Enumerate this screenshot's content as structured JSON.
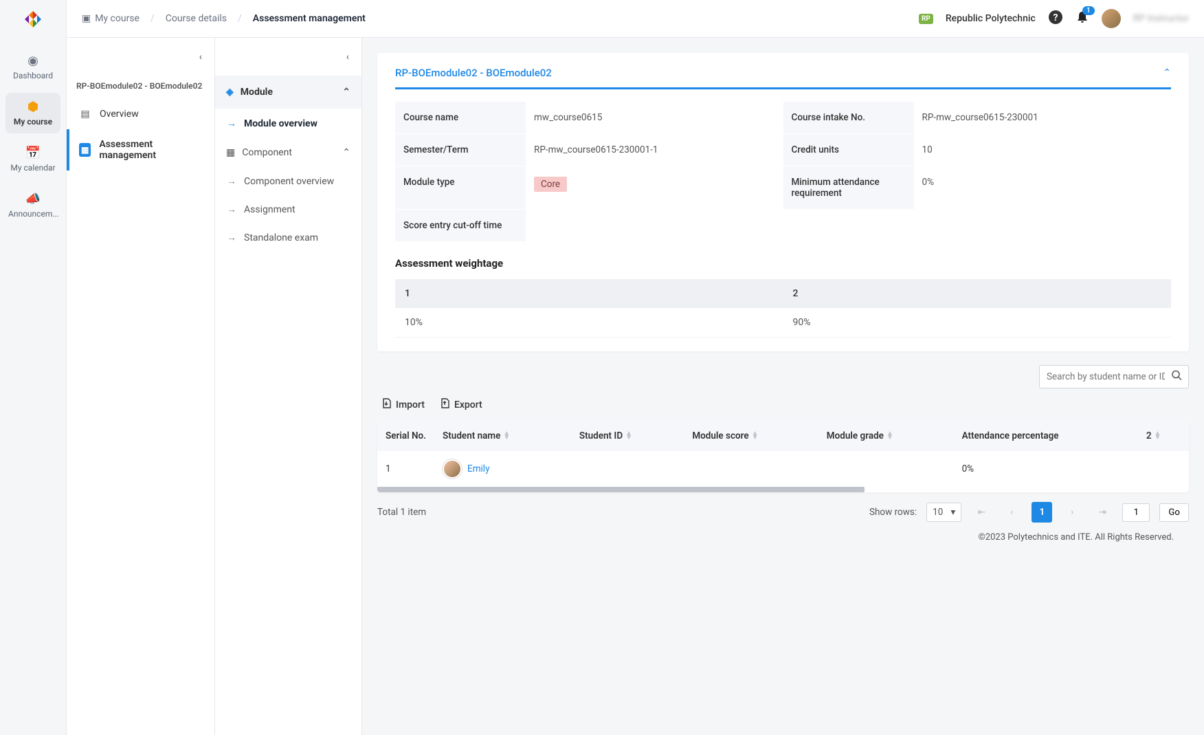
{
  "rail": {
    "dashboard": "Dashboard",
    "mycourse": "My course",
    "calendar": "My calendar",
    "announce": "Announcem..."
  },
  "breadcrumb": {
    "a": "My course",
    "b": "Course details",
    "c": "Assessment management"
  },
  "top": {
    "org": "Republic Polytechnic",
    "notif_count": "1",
    "user": "RP Instructor"
  },
  "panel1": {
    "course_code": "RP-BOEmodule02 - BOEmodule02",
    "overview": "Overview",
    "assess": "Assessment management"
  },
  "panel2": {
    "module": "Module",
    "mod_overview": "Module overview",
    "component": "Component",
    "comp_overview": "Component overview",
    "assignment": "Assignment",
    "standalone": "Standalone exam"
  },
  "card": {
    "title": "RP-BOEmodule02 - BOEmodule02",
    "labels": {
      "course_name": "Course name",
      "intake": "Course intake No.",
      "semester": "Semester/Term",
      "credits": "Credit units",
      "mtype": "Module type",
      "min_att": "Minimum attendance requirement",
      "cutoff": "Score entry cut-off time"
    },
    "values": {
      "course_name": "mw_course0615",
      "intake": "RP-mw_course0615-230001",
      "semester": "RP-mw_course0615-230001-1",
      "credits": "10",
      "mtype": "Core",
      "min_att": "0%",
      "cutoff": ""
    },
    "aw_title": "Assessment weightage",
    "aw_head": {
      "c1": "1",
      "c2": "2"
    },
    "aw_row": {
      "c1": "10%",
      "c2": "90%"
    }
  },
  "search": {
    "placeholder": "Search by student name or ID"
  },
  "actions": {
    "import": "Import",
    "export": "Export"
  },
  "table": {
    "headers": {
      "serial": "Serial No.",
      "name": "Student name",
      "sid": "Student ID",
      "mscore": "Module score",
      "mgrade": "Module grade",
      "att": "Attendance percentage",
      "extra": "2"
    },
    "rows": [
      {
        "serial": "1",
        "name": "Emily",
        "sid": "",
        "mscore": "",
        "mgrade": "",
        "att": "0%",
        "extra": ""
      }
    ]
  },
  "pager": {
    "total": "Total 1 item",
    "show_rows": "Show rows:",
    "rows_val": "10",
    "page": "1",
    "input": "1",
    "go": "Go"
  },
  "footer": "©2023 Polytechnics and ITE. All Rights Reserved."
}
